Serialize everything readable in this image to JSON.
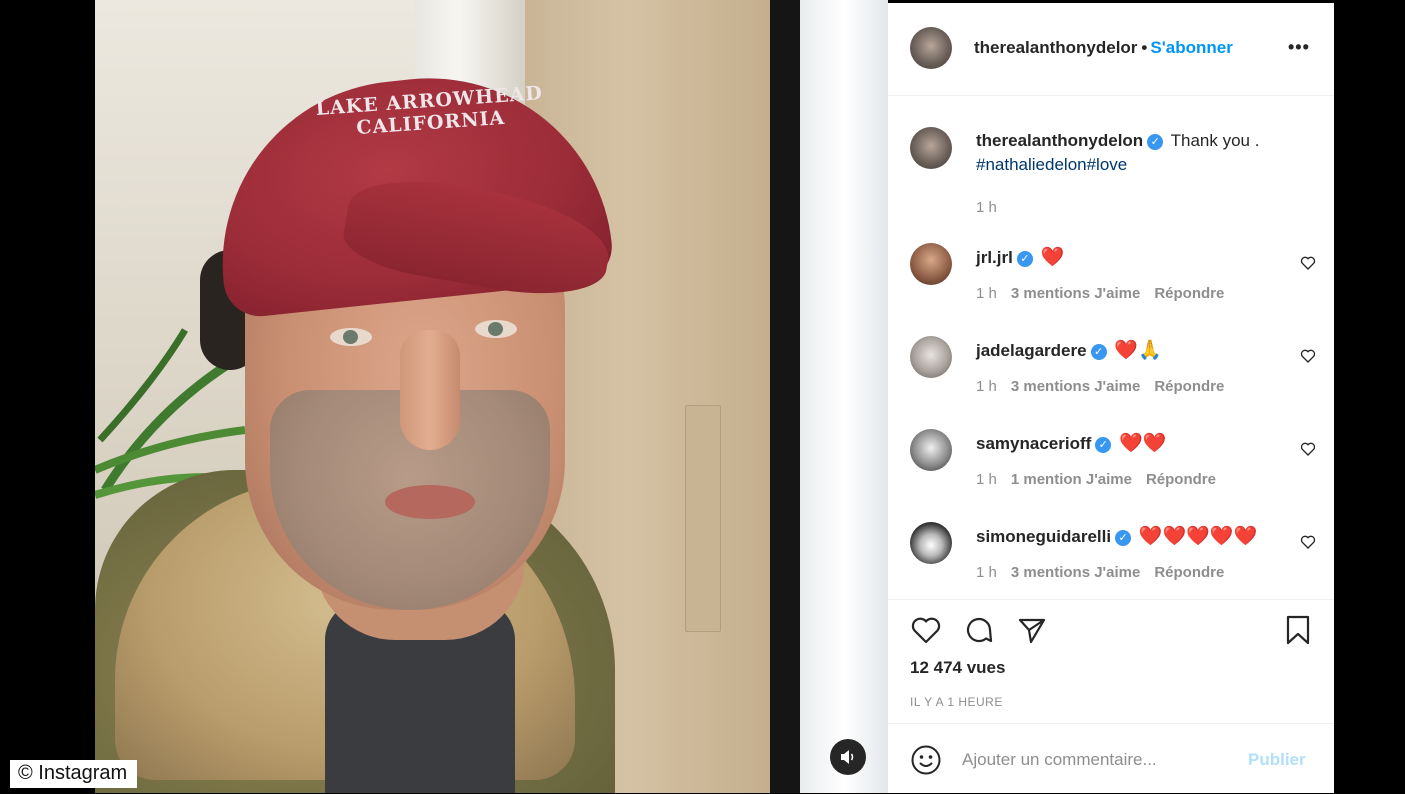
{
  "credit": "© Instagram",
  "post": {
    "username": "therealanthonydelor",
    "follow_label": "S'abonner",
    "more_label": "•••"
  },
  "caption": {
    "username": "therealanthonydelon",
    "text": "Thank you .",
    "hashtags": "#nathaliedelon#love",
    "time": "1 h"
  },
  "comments": [
    {
      "username": "jrl.jrl",
      "text": "❤️",
      "time": "1 h",
      "likes": "3 mentions J'aime",
      "reply": "Répondre"
    },
    {
      "username": "jadelagardere",
      "text": "❤️🙏",
      "time": "1 h",
      "likes": "3 mentions J'aime",
      "reply": "Répondre"
    },
    {
      "username": "samynacerioff",
      "text": "❤️❤️",
      "time": "1 h",
      "likes": "1 mention J'aime",
      "reply": "Répondre"
    },
    {
      "username": "simoneguidarelli",
      "text": "❤️❤️❤️❤️❤️",
      "time": "1 h",
      "likes": "3 mentions J'aime",
      "reply": "Répondre"
    }
  ],
  "stats": {
    "views": "12 474 vues",
    "ago": "IL Y A 1 HEURE"
  },
  "add_comment": {
    "placeholder": "Ajouter un commentaire...",
    "publish": "Publier"
  },
  "video": {
    "cap_line1": "LAKE ARROWHEAD",
    "cap_line2": "CALIFORNIA"
  },
  "colors": {
    "link": "#0095f6",
    "verified": "#3897f0",
    "muted": "#8e8e8e",
    "publish_disabled": "#b2dffc"
  }
}
